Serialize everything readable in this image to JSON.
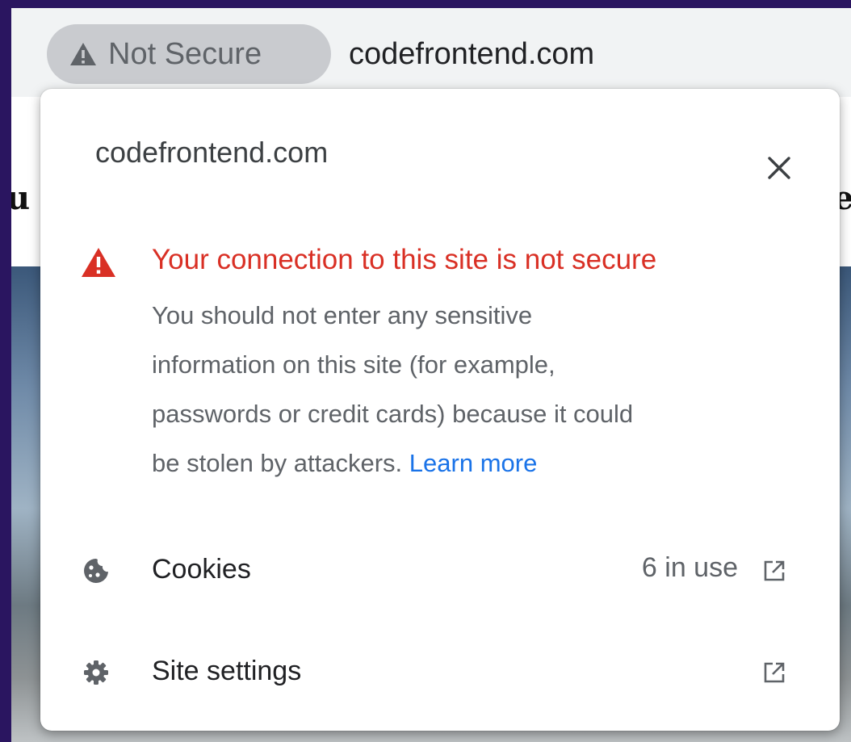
{
  "toolbar": {
    "security_chip_label": "Not Secure",
    "security_chip_icon": "warning-triangle-icon",
    "url": "codefrontend.com"
  },
  "page_background": {
    "left_fragment": "u",
    "right_fragment": "e"
  },
  "site_info_popup": {
    "site_name": "codefrontend.com",
    "close_icon": "close-icon",
    "warning": {
      "icon": "warning-triangle-icon",
      "title": "Your connection to this site is not secure",
      "body_lines": [
        "You should not enter any sensitive",
        "information on this site (for example,",
        "passwords or credit cards) because it could",
        "be stolen by attackers."
      ],
      "learn_more": "Learn more"
    },
    "rows": [
      {
        "icon": "cookie-icon",
        "label": "Cookies",
        "value": "6 in use",
        "trailing_icon": "open-external-icon"
      },
      {
        "icon": "gear-icon",
        "label": "Site settings",
        "trailing_icon": "open-external-icon"
      }
    ]
  },
  "colors": {
    "warning_red": "#d93025",
    "link_blue": "#1a73e8",
    "chip_gray": "#c9cbcf",
    "text_gray": "#5f6368",
    "desktop_purple": "#2a1560"
  }
}
